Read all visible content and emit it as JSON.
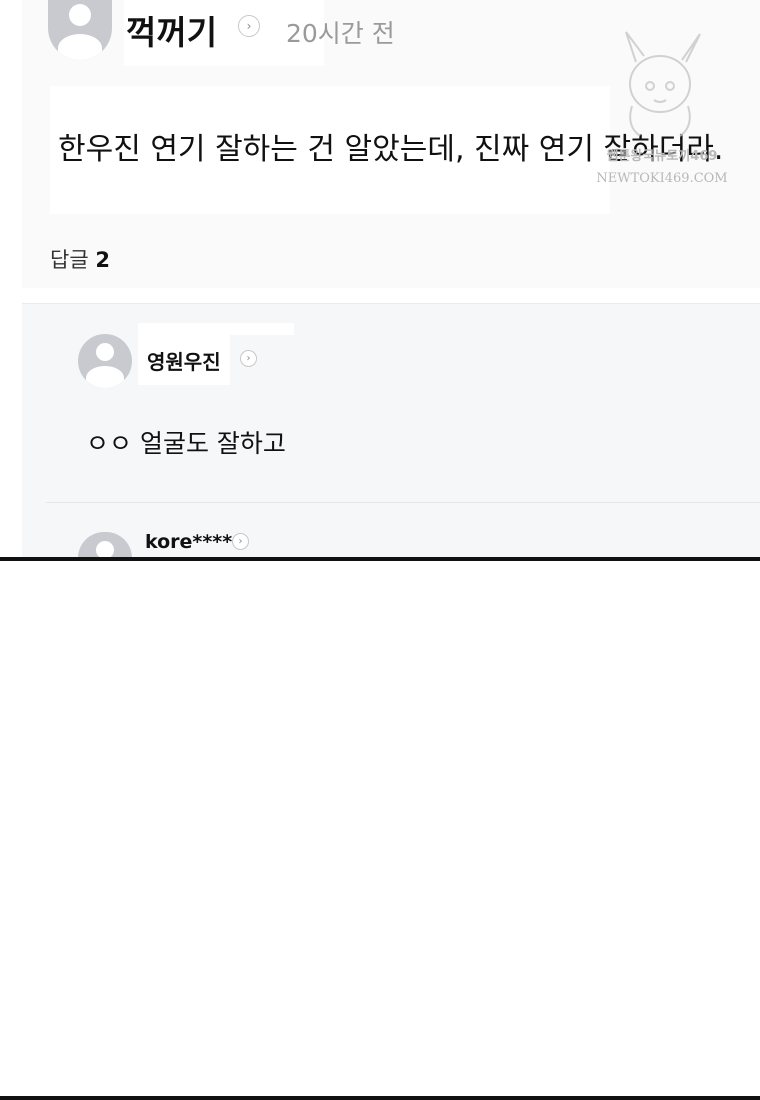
{
  "comment": {
    "author": "꺽꺼기",
    "time": "20시간 전",
    "text": "한우진 연기 잘하는 건 알았는데, 진짜 연기 잘하더라."
  },
  "replies_header": {
    "label": "답글",
    "count": "2"
  },
  "replies": [
    {
      "author": "영원우진",
      "text": "ㅇㅇ 얼굴도 잘하고"
    },
    {
      "author": "kore****",
      "text": ""
    }
  ],
  "watermark": {
    "line1": "웹툰왕국뉴토끼469",
    "line2": "NEWTOKI469.COM"
  },
  "colors": {
    "avatar": "#c9cacf",
    "panel": "#fafafa",
    "replies_panel": "#f6f7f9",
    "muted_text": "#9a9a9a"
  }
}
